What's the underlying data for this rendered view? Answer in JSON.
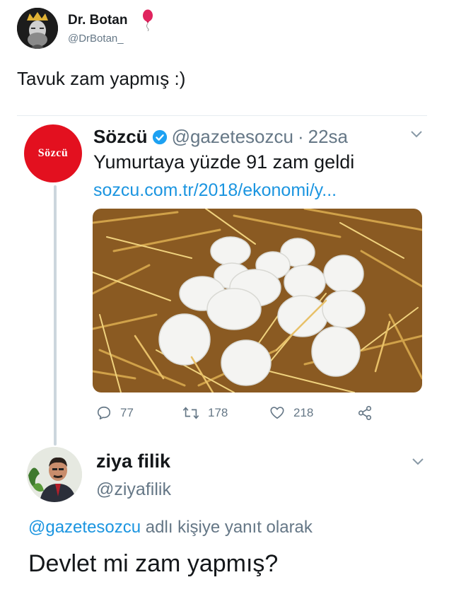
{
  "author": {
    "name": "Dr. Botan",
    "handle": "@DrBotan_",
    "badge_icon": "balloon-icon"
  },
  "tweet": {
    "text": "Tavuk zam yapmış :)"
  },
  "quoted": {
    "avatar_text": "Sözcü",
    "name": "Sözcü",
    "handle": "@gazetesozcu",
    "separator": "·",
    "time": "22sa",
    "text": "Yumurtaya yüzde 91 zam geldi",
    "link": "sozcu.com.tr/2018/ekonomi/y...",
    "actions": {
      "reply_count": "77",
      "retweet_count": "178",
      "like_count": "218"
    }
  },
  "reply": {
    "name": "ziya filik",
    "handle": "@ziyafilik",
    "reply_to_mention": "@gazetesozcu",
    "reply_to_suffix": " adlı kişiye yanıt olarak",
    "text": "Devlet mi zam yapmış?"
  },
  "colors": {
    "link": "#1b95e0",
    "muted": "#657786",
    "sozcu_red": "#e3101f",
    "verified": "#1da1f2"
  }
}
